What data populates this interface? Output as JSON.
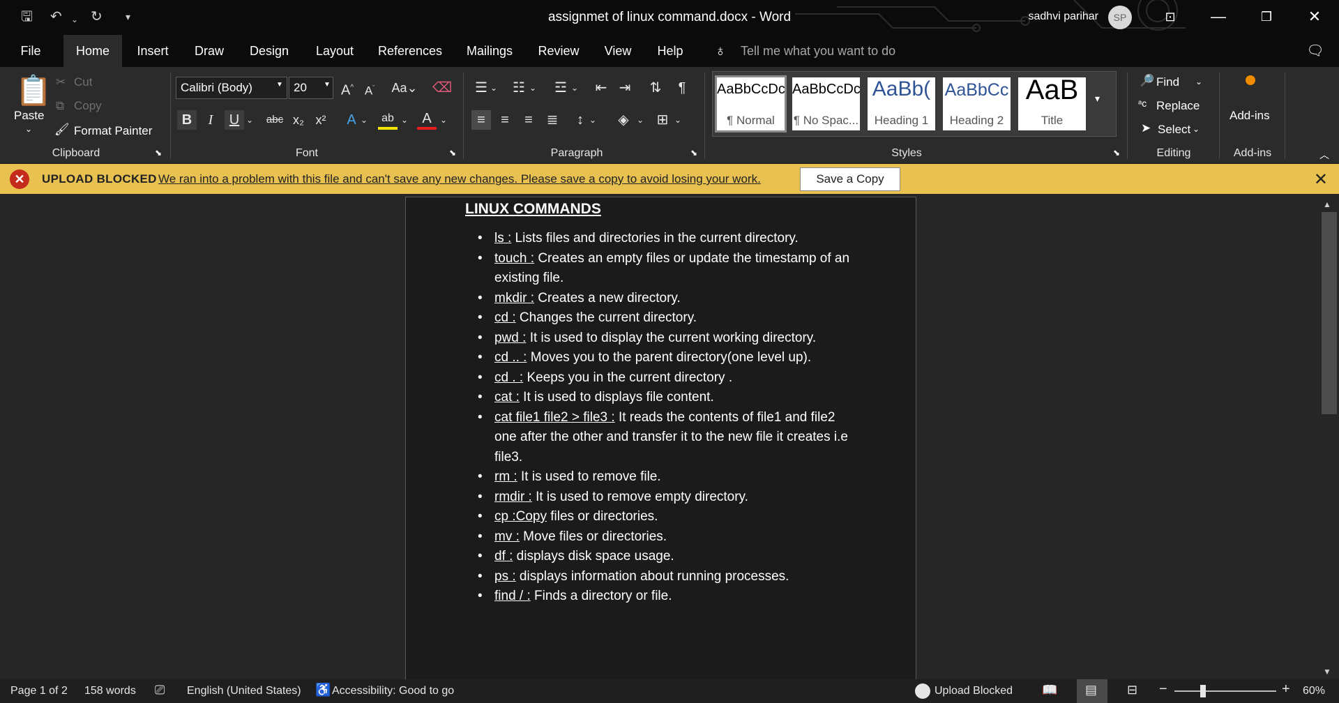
{
  "titlebar": {
    "title": "assignmet of linux command.docx  -  Word",
    "user_name": "sadhvi parihar",
    "avatar_initials": "SP",
    "icons": [
      "autosave-icon",
      "undo-icon",
      "redo-icon",
      "customize-qat-icon",
      "ribbon-display-icon",
      "minimize-icon",
      "restore-icon",
      "close-icon"
    ]
  },
  "menu_tabs": [
    "File",
    "Home",
    "Insert",
    "Draw",
    "Design",
    "Layout",
    "References",
    "Mailings",
    "Review",
    "View",
    "Help"
  ],
  "active_tab": "Home",
  "tell_me": "Tell me what you want to do",
  "ribbon": {
    "clipboard": {
      "paste": "Paste",
      "cut": "Cut",
      "copy": "Copy",
      "format_painter": "Format Painter",
      "label": "Clipboard"
    },
    "font": {
      "family": "Calibri (Body)",
      "size": "20",
      "label": "Font"
    },
    "paragraph": {
      "label": "Paragraph"
    },
    "styles": {
      "label": "Styles",
      "items": [
        {
          "sample": "AaBbCcDc",
          "name": "¶ Normal"
        },
        {
          "sample": "AaBbCcDc",
          "name": "¶ No Spac..."
        },
        {
          "sample": "AaBb(",
          "name": "Heading 1"
        },
        {
          "sample": "AaBbCc",
          "name": "Heading 2"
        },
        {
          "sample": "AaB",
          "name": "Title"
        }
      ]
    },
    "editing": {
      "find": "Find",
      "replace": "Replace",
      "select": "Select",
      "label": "Editing"
    },
    "addins": {
      "button": "Add-ins",
      "label": "Add-ins"
    }
  },
  "infobar": {
    "title": "UPLOAD BLOCKED",
    "message": "We ran into a problem with this file and can't save any new changes. Please save a copy to avoid losing your work.",
    "button": "Save a Copy",
    "accent": "#e8c150"
  },
  "document": {
    "heading": "LINUX COMMANDS",
    "items": [
      {
        "cmd": "ls :",
        "text": " Lists files and directories in the current directory."
      },
      {
        "cmd": "touch :",
        "text": " Creates an empty files or update the timestamp of an existing file."
      },
      {
        "cmd": "mkdir :",
        "text": " Creates a new directory."
      },
      {
        "cmd": "cd :",
        "text": " Changes the current directory."
      },
      {
        "cmd": "pwd :",
        "text": " It is used to display the current working directory."
      },
      {
        "cmd": "cd .. :",
        "text": " Moves you to the parent directory(one level up)."
      },
      {
        "cmd": "cd . :",
        "text": " Keeps you in the current directory ."
      },
      {
        "cmd": "cat :",
        "text": " It is used to displays file content."
      },
      {
        "cmd": "cat file1 file2 > file3 :",
        "text": " It reads the contents of file1 and file2 one after the other and transfer it to the new file it creates i.e file3."
      },
      {
        "cmd": "rm :",
        "text": " It is used to remove file."
      },
      {
        "cmd": "rmdir :",
        "text": " It is used to remove empty directory."
      },
      {
        "cmd": "cp :Copy",
        "text": " files or directories."
      },
      {
        "cmd": "mv :",
        "text": " Move files or directories."
      },
      {
        "cmd": "df :",
        "text": " displays disk space usage."
      },
      {
        "cmd": "ps :",
        "text": " displays information about running processes."
      },
      {
        "cmd": "find / :",
        "text": " Finds a directory or file."
      }
    ]
  },
  "statusbar": {
    "page": "Page 1 of 2",
    "words": "158 words",
    "language": "English (United States)",
    "accessibility": "Accessibility: Good to go",
    "upload": "Upload Blocked",
    "zoom": "60%"
  }
}
